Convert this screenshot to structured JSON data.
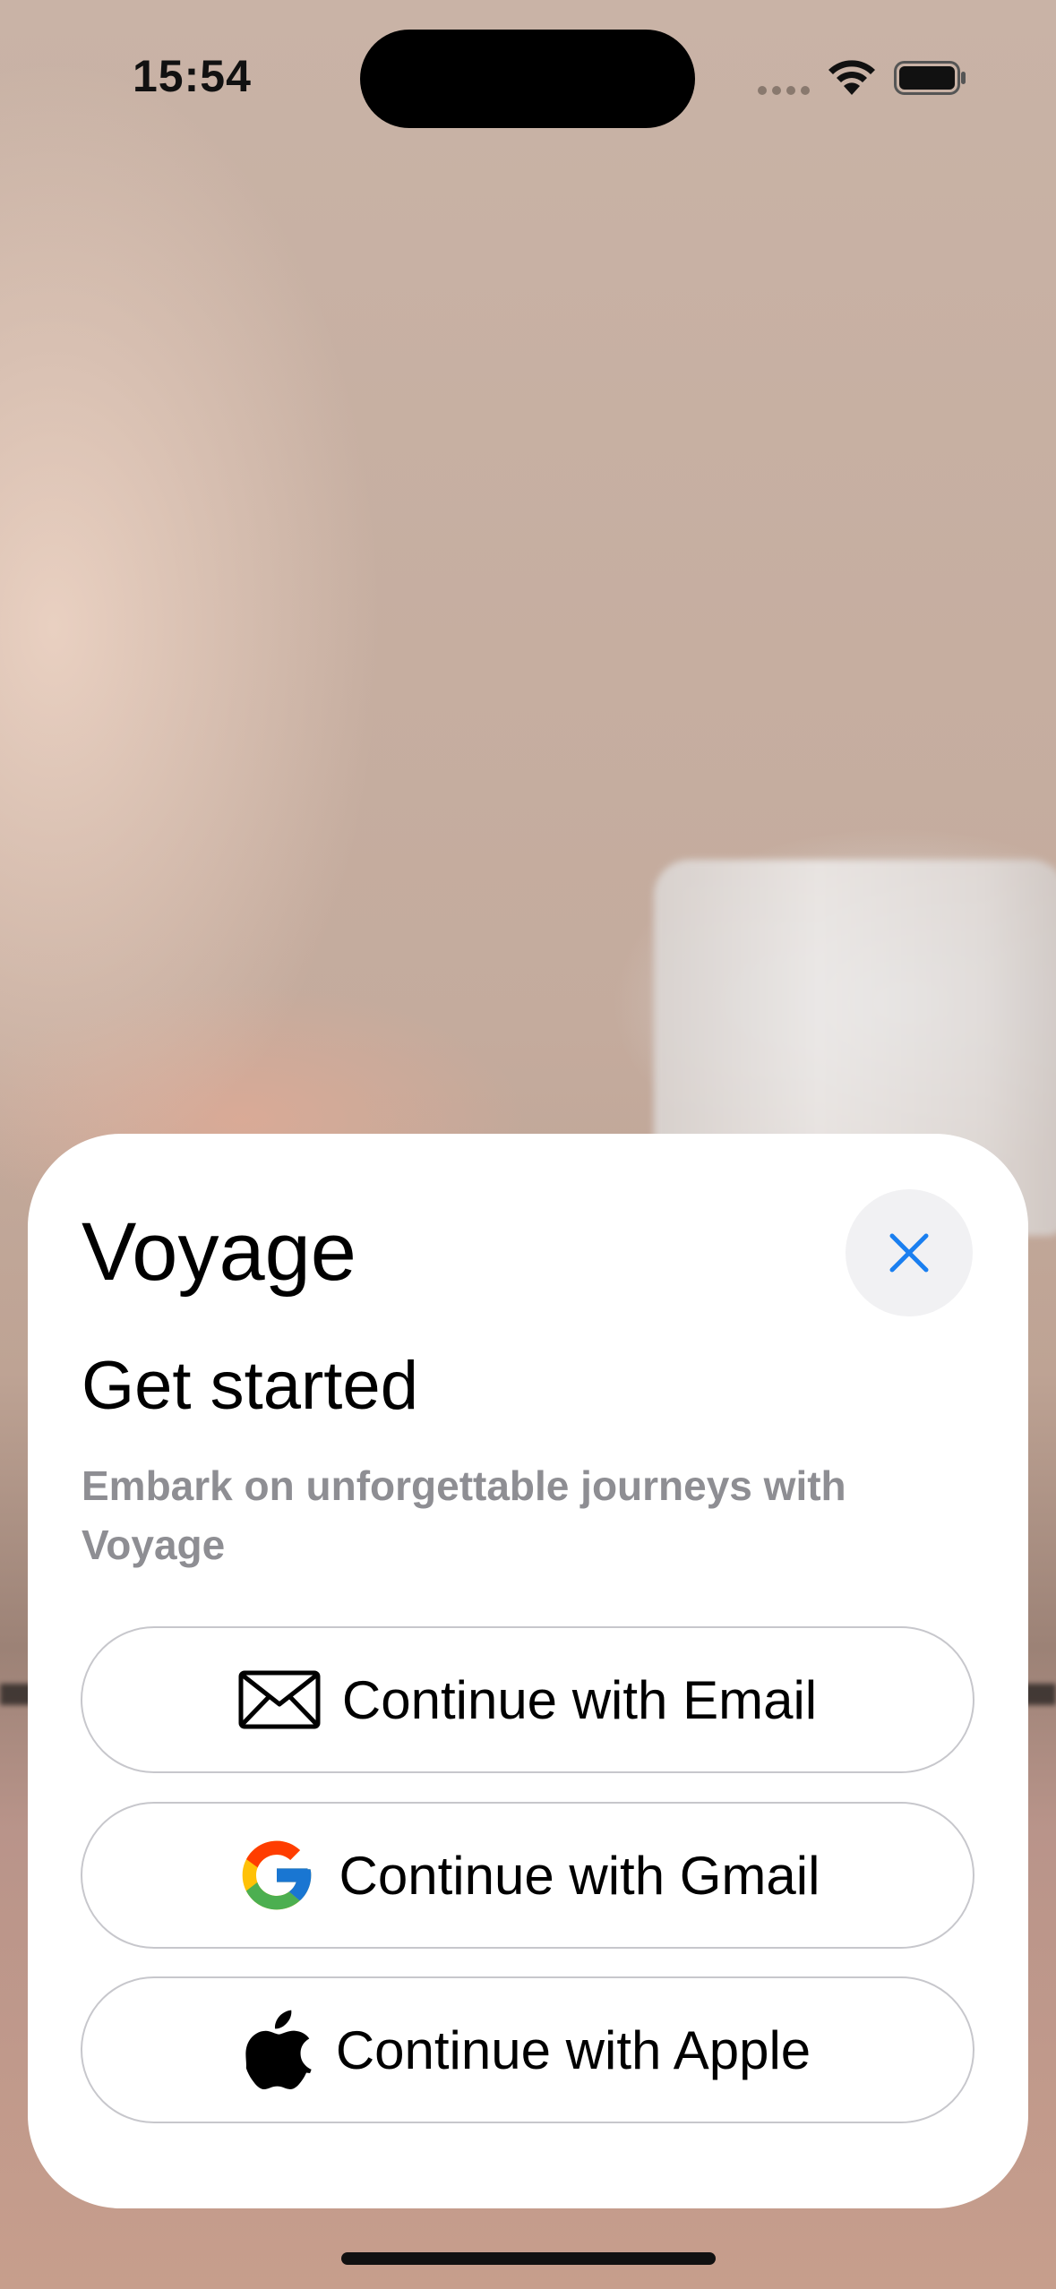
{
  "status_bar": {
    "time": "15:54"
  },
  "sheet": {
    "app_name": "Voyage",
    "heading": "Get started",
    "subtitle": "Embark on unforgettable journeys with Voyage",
    "close_icon": "close-icon",
    "buttons": [
      {
        "label": "Continue with Email",
        "icon": "envelope-icon"
      },
      {
        "label": "Continue with Gmail",
        "icon": "google-icon"
      },
      {
        "label": "Continue with Apple",
        "icon": "apple-icon"
      }
    ]
  },
  "colors": {
    "accent": "#1a7ff0",
    "sheet_background": "#ffffff",
    "close_button_background": "#f1f1f3",
    "subtitle_text": "#8e8e93",
    "button_border": "#c7c7cc"
  }
}
